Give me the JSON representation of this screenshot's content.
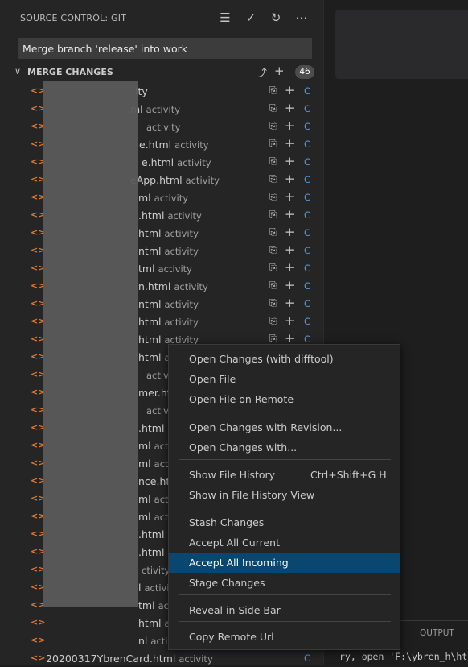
{
  "header": {
    "title": "SOURCE CONTROL: GIT"
  },
  "commit": {
    "value": "Merge branch 'release' into work"
  },
  "group": {
    "label": "MERGE CHANGES",
    "count": "46"
  },
  "colors": {
    "highlight": "#094771",
    "file_icon": "#e37933",
    "status": "#4d9be6"
  },
  "files": [
    {
      "name": "ity",
      "dir": ""
    },
    {
      "name": "ml",
      "dir": "activity"
    },
    {
      "name": "",
      "dir": "activity"
    },
    {
      "name": "e.html",
      "dir": "activity"
    },
    {
      "name": "e.html",
      "dir": "activity"
    },
    {
      "name": "eApp.html",
      "dir": "activity"
    },
    {
      "name": "ml",
      "dir": "activity"
    },
    {
      "name": ".html",
      "dir": "activity"
    },
    {
      "name": "html",
      "dir": "activity"
    },
    {
      "name": "ntml",
      "dir": "activity"
    },
    {
      "name": "tml",
      "dir": "activity"
    },
    {
      "name": "n.html",
      "dir": "activity"
    },
    {
      "name": "ntml",
      "dir": "activity"
    },
    {
      "name": "html",
      "dir": "activity"
    },
    {
      "name": "html",
      "dir": "activity"
    },
    {
      "name": "html",
      "dir": "a"
    },
    {
      "name": "",
      "dir": "activit"
    },
    {
      "name": "mer.ht",
      "dir": ""
    },
    {
      "name": "",
      "dir": "activit"
    },
    {
      "name": ".html",
      "dir": ""
    },
    {
      "name": "ml",
      "dir": "acti"
    },
    {
      "name": "ml",
      "dir": "acti"
    },
    {
      "name": "nce.htr",
      "dir": ""
    },
    {
      "name": "ml",
      "dir": "acti"
    },
    {
      "name": "ml",
      "dir": "acti"
    },
    {
      "name": ".html",
      "dir": ""
    },
    {
      "name": ".html",
      "dir": ""
    },
    {
      "name": "",
      "dir": "ctivity"
    },
    {
      "name": "l",
      "dir": "activi"
    },
    {
      "name": "tml",
      "dir": "act"
    },
    {
      "name": "html",
      "dir": "a"
    },
    {
      "name": "nl",
      "dir": "activ"
    },
    {
      "name": "20200317YbrenCard.html",
      "dir": "activity"
    }
  ],
  "file_row": {
    "icon": "<>",
    "status": "C"
  },
  "context_menu": {
    "items": [
      {
        "label": "Open Changes (with difftool)"
      },
      {
        "label": "Open File"
      },
      {
        "label": "Open File on Remote"
      },
      {
        "label": "Open Changes with Revision..."
      },
      {
        "label": "Open Changes with..."
      },
      {
        "label": "Show File History",
        "shortcut": "Ctrl+Shift+G H"
      },
      {
        "label": "Show in File History View"
      },
      {
        "label": "Stash Changes"
      },
      {
        "label": "Accept All Current"
      },
      {
        "label": "Accept All Incoming"
      },
      {
        "label": "Stage Changes"
      },
      {
        "label": "Reveal in Side Bar"
      },
      {
        "label": "Copy Remote Url"
      }
    ]
  },
  "panel": {
    "tab": "OUTPUT",
    "text": "ry, open 'F:\\ybren_h\\ht"
  }
}
